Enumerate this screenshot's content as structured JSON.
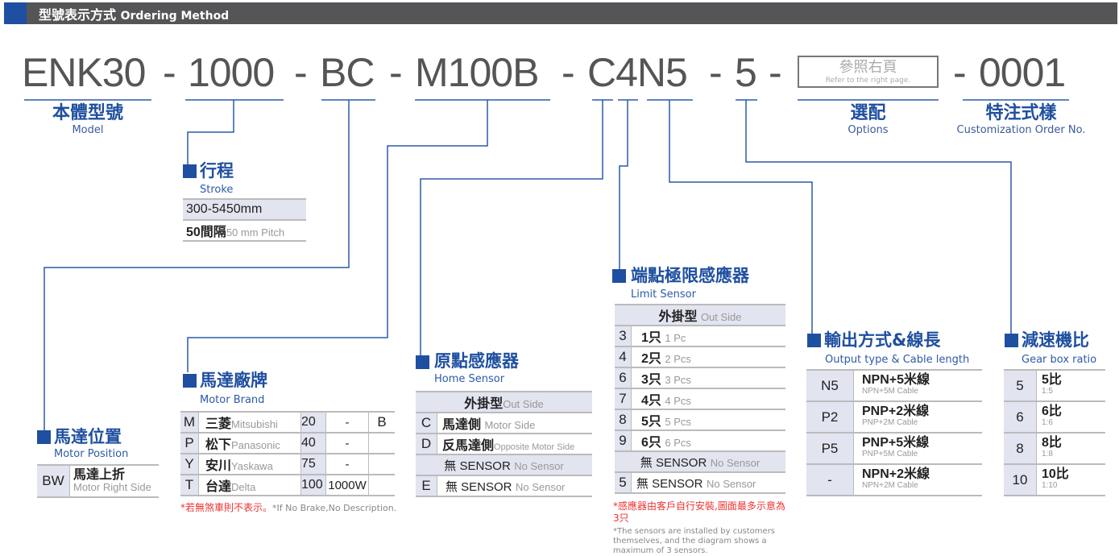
{
  "header": {
    "title_zh": "型號表示方式",
    "title_en": "Ordering Method",
    "accent_color": "#1f4fa0",
    "bar_color": "#555557"
  },
  "code": {
    "model": "ENK30",
    "stroke": "1000",
    "motor_position": "BC",
    "motor_brand": "M100B",
    "sensors_output": "C4N5",
    "gear_ratio": "5",
    "customization": "0001",
    "dash": "-",
    "options_box": {
      "zh": "參照右頁",
      "en": "Refer to the right page."
    }
  },
  "labels": {
    "model": {
      "zh": "本體型號",
      "en": "Model"
    },
    "options": {
      "zh": "選配",
      "en": "Options"
    },
    "custom": {
      "zh": "特注式樣",
      "en": "Customization Order No."
    }
  },
  "stroke": {
    "zh": "行程",
    "en": "Stroke",
    "range": "300-5450mm",
    "pitch_zh": "50間隔",
    "pitch_en": "50 mm Pitch"
  },
  "motor_position": {
    "zh": "馬達位置",
    "en": "Motor Position",
    "rows": [
      {
        "code": "BW",
        "zh": "馬達上折",
        "en": "Motor Right Side"
      }
    ]
  },
  "motor_brand": {
    "zh": "馬達廠牌",
    "en": "Motor Brand",
    "rows": [
      {
        "code": "M",
        "zh": "三菱",
        "en": "Mitsubishi",
        "watt": "20",
        "extra": "-",
        "brake": "B"
      },
      {
        "code": "P",
        "zh": "松下",
        "en": "Panasonic",
        "watt": "40",
        "extra": "-",
        "brake": ""
      },
      {
        "code": "Y",
        "zh": "安川",
        "en": "Yaskawa",
        "watt": "75",
        "extra": "-",
        "brake": ""
      },
      {
        "code": "T",
        "zh": "台達",
        "en": "Delta",
        "watt": "100",
        "extra": "1000W",
        "brake": ""
      }
    ],
    "note_zh": "*若無煞車則不表示。",
    "note_en": "*If No Brake,No Description."
  },
  "home_sensor": {
    "zh": "原點感應器",
    "en": "Home Sensor",
    "group1_zh": "外掛型",
    "group1_en": "Out Side",
    "rows": [
      {
        "code": "C",
        "zh": "馬達側",
        "en": "Motor Side"
      },
      {
        "code": "D",
        "zh": "反馬達側",
        "en": "Opposite Motor Side"
      }
    ],
    "group2_zh": "無 SENSOR",
    "group2_en": "No Sensor",
    "none_row": {
      "code": "E",
      "zh": "無 SENSOR",
      "en": "No Sensor"
    }
  },
  "limit_sensor": {
    "zh": "端點極限感應器",
    "en": "Limit Sensor",
    "group1_zh": "外掛型",
    "group1_en": "Out Side",
    "rows": [
      {
        "code": "3",
        "zh": "1只",
        "en": "1 Pc"
      },
      {
        "code": "4",
        "zh": "2只",
        "en": "2 Pcs"
      },
      {
        "code": "6",
        "zh": "3只",
        "en": "3 Pcs"
      },
      {
        "code": "7",
        "zh": "4只",
        "en": "4 Pcs"
      },
      {
        "code": "8",
        "zh": "5只",
        "en": "5 Pcs"
      },
      {
        "code": "9",
        "zh": "6只",
        "en": "6 Pcs"
      }
    ],
    "group2_zh": "無 SENSOR",
    "group2_en": "No Sensor",
    "none_row": {
      "code": "5",
      "zh": "無 SENSOR",
      "en": "No Sensor"
    },
    "note_zh": "*感應器由客戶自行安裝,圖面最多示意為3只",
    "note_en": "*The sensors are installed by customers themselves, and the diagram shows a maximum of 3 sensors."
  },
  "output_type": {
    "zh": "輸出方式&線長",
    "en": "Output type & Cable length",
    "rows": [
      {
        "code": "N5",
        "zh": "NPN+5米線",
        "en": "NPN+5M Cable"
      },
      {
        "code": "P2",
        "zh": "PNP+2米線",
        "en": "PNP+2M Cable"
      },
      {
        "code": "P5",
        "zh": "PNP+5米線",
        "en": "PNP+5M Cable"
      },
      {
        "code": "-",
        "zh": "NPN+2米線",
        "en": "NPN+2M Cable"
      }
    ]
  },
  "gear_ratio": {
    "zh": "減速機比",
    "en": "Gear box ratio",
    "rows": [
      {
        "code": "5",
        "zh": "5比",
        "en": "1:5"
      },
      {
        "code": "6",
        "zh": "6比",
        "en": "1:6"
      },
      {
        "code": "8",
        "zh": "8比",
        "en": "1:8"
      },
      {
        "code": "10",
        "zh": "10比",
        "en": "1:10"
      }
    ]
  }
}
